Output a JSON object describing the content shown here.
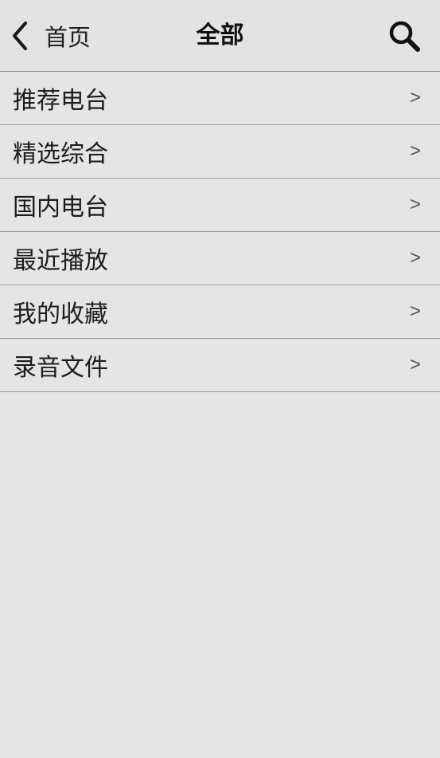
{
  "header": {
    "back_label": "首页",
    "title": "全部",
    "back_icon": "chevron-left-icon",
    "search_icon": "search-icon"
  },
  "list": {
    "items": [
      {
        "label": "推荐电台",
        "arrow": ">"
      },
      {
        "label": "精选综合",
        "arrow": ">"
      },
      {
        "label": "国内电台",
        "arrow": ">"
      },
      {
        "label": "最近播放",
        "arrow": ">"
      },
      {
        "label": "我的收藏",
        "arrow": ">"
      },
      {
        "label": "录音文件",
        "arrow": ">"
      }
    ]
  },
  "colors": {
    "background": "#e5e5e5",
    "divider": "#9a9a9a",
    "text": "#1c1c1c"
  }
}
